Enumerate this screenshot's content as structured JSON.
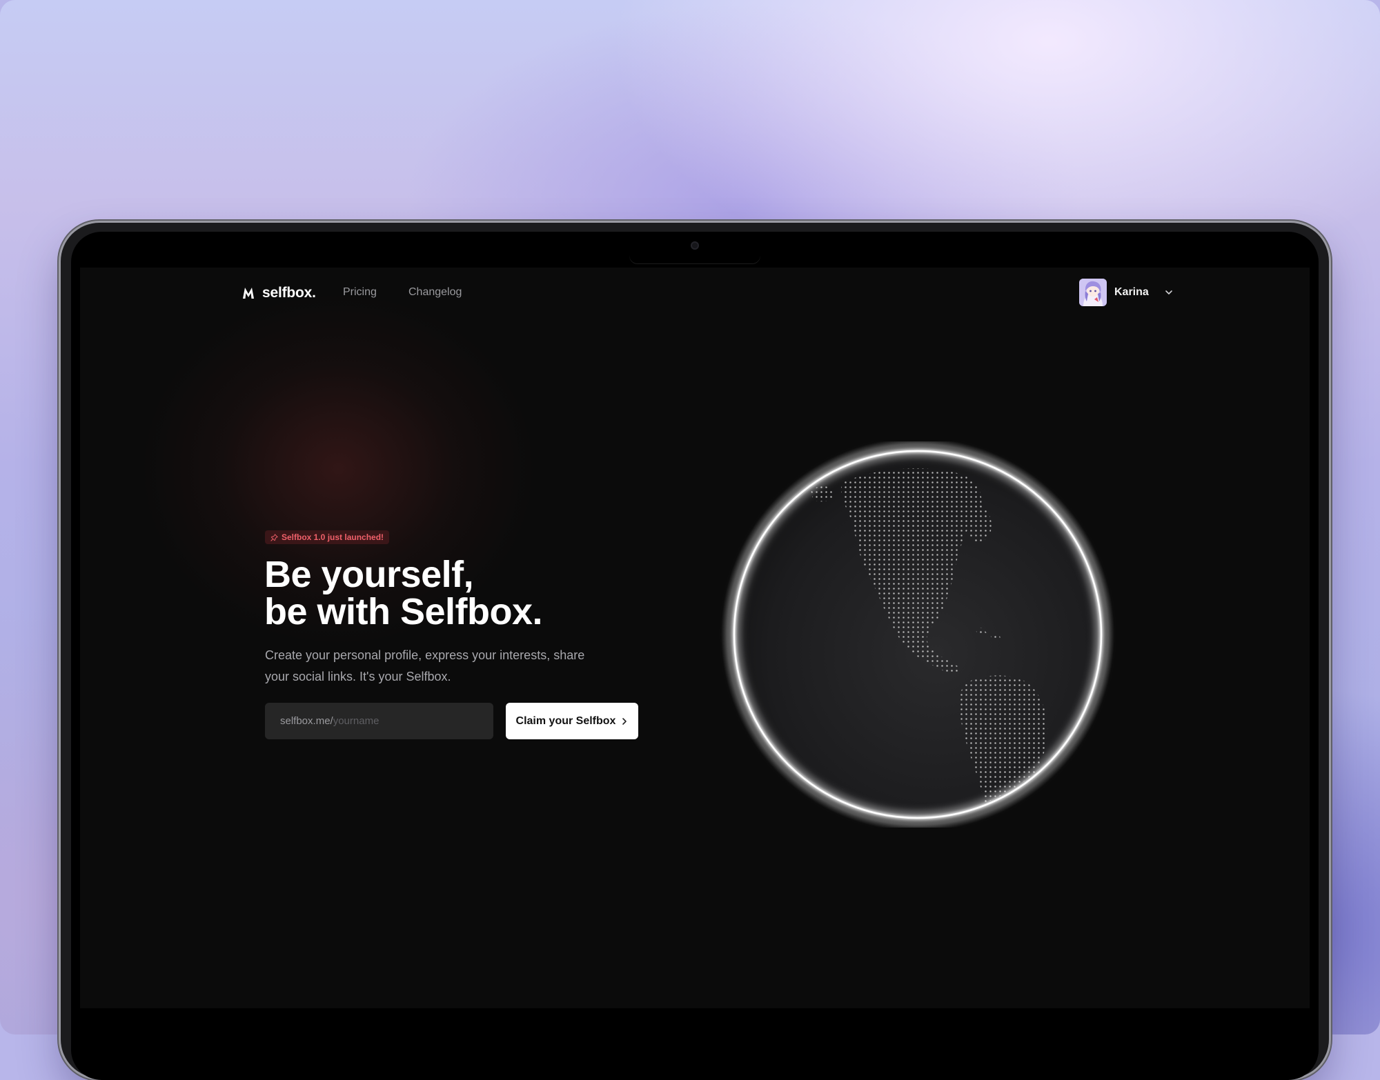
{
  "app": {
    "brand": "selfbox.",
    "accent_color": "#f0606a"
  },
  "nav": {
    "links": [
      {
        "label": "Pricing"
      },
      {
        "label": "Changelog"
      }
    ],
    "user": {
      "name": "Karina",
      "avatar_icon": "user-avatar",
      "menu_icon": "chevron-down-icon"
    }
  },
  "hero": {
    "badge": "Selfbox 1.0 just launched!",
    "badge_icon": "pin-icon",
    "headline_line1": "Be yourself,",
    "headline_line2": "be with Selfbox.",
    "description": "Create your personal profile, express your interests, share your social links. It's your Selfbox.",
    "url_prefix": "selfbox.me/",
    "url_placeholder": "yourname",
    "cta_label": "Claim your Selfbox",
    "cta_icon": "chevron-right-icon"
  },
  "visual": {
    "globe_icon": "globe-icon"
  }
}
